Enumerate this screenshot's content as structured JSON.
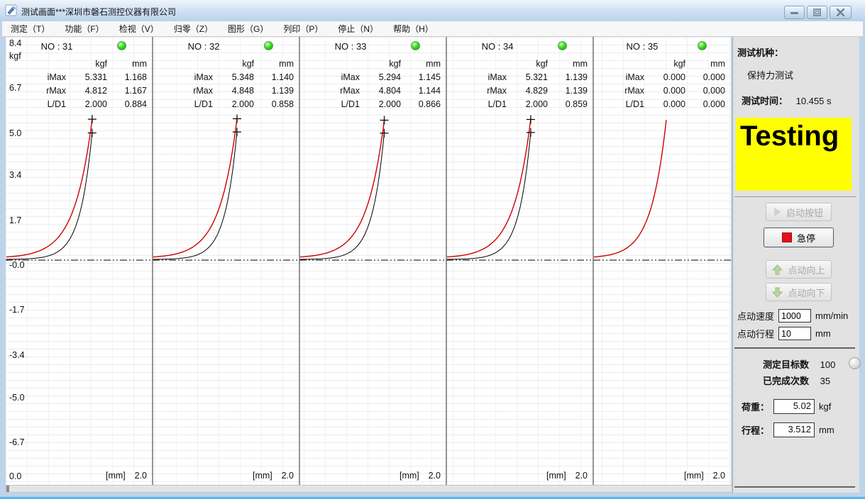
{
  "window": {
    "title": "测试画面***深圳市磐石测控仪器有限公司",
    "minimize_glyph": "—",
    "close_glyph": "✕"
  },
  "menu": {
    "items": [
      "测定（T）",
      "功能（F）",
      "检视（V）",
      "归零（Z）",
      "图形（G）",
      "列印（P）",
      "停止（N）",
      "帮助（H）"
    ]
  },
  "sidebar": {
    "machine_type_label": "测试机种：",
    "machine_type_value": "保持力测试",
    "test_time_label": "测试时间：",
    "test_time_value": "10.455 s",
    "status_banner": "Testing",
    "banner_bg": "#ffff00",
    "start_button": "启动按钮",
    "estop_button": "急停",
    "jog_up_button": "点动向上",
    "jog_down_button": "点动向下",
    "jog_speed_label": "点动速度",
    "jog_speed_value": "1000",
    "jog_speed_unit": "mm/min",
    "jog_stroke_label": "点动行程",
    "jog_stroke_value": "10",
    "jog_stroke_unit": "mm",
    "target_count_label": "测定目标数",
    "target_count_value": "100",
    "completed_label": "已完成次数",
    "completed_value": "35",
    "load_label": "荷重：",
    "load_value": "5.02",
    "load_unit": "kgf",
    "stroke_label": "行程：",
    "stroke_value": "3.512",
    "stroke_unit": "mm"
  },
  "chart_data": {
    "type": "line",
    "title": "Holding-force test curves, force (kgf) vs displacement (mm), 5 consecutive test cycles",
    "y_unit": "kgf",
    "ylim": [
      -8.4,
      8.4
    ],
    "y_ticks": [
      {
        "label": "8.4",
        "v": 8.4
      },
      {
        "label": "6.7",
        "v": 6.7
      },
      {
        "label": "5.0",
        "v": 5.0
      },
      {
        "label": "3.4",
        "v": 3.4
      },
      {
        "label": "1.7",
        "v": 1.7
      },
      {
        "label": "-0.0",
        "v": 0
      },
      {
        "label": "-1.7",
        "v": -1.7
      },
      {
        "label": "-3.4",
        "v": -3.4
      },
      {
        "label": "-5.0",
        "v": -5.0
      },
      {
        "label": "-6.7",
        "v": -6.7
      }
    ],
    "x_origin_label": "0.0",
    "x_axis_label": "[mm]",
    "x_max_label": "2.0",
    "x_range": [
      0,
      2
    ],
    "grid": true,
    "series_colors": {
      "load": "#cf0000",
      "return": "#000000"
    },
    "col_headers": [
      "kgf",
      "mm"
    ],
    "panels": [
      {
        "no_label": "NO : 31",
        "led": "green",
        "markers": true,
        "rows": [
          {
            "label": "iMax",
            "kgf": "5.331",
            "mm": "1.168"
          },
          {
            "label": "rMax",
            "kgf": "4.812",
            "mm": "1.167"
          },
          {
            "label": "L/D1",
            "kgf": "2.000",
            "mm": "0.884"
          }
        ],
        "curves": {
          "red": {
            "peak_kgf": 5.331,
            "peak_mm": 1.168
          },
          "black": {
            "peak_kgf": 4.812,
            "peak_mm": 1.167
          }
        }
      },
      {
        "no_label": "NO : 32",
        "led": "green",
        "markers": true,
        "rows": [
          {
            "label": "iMax",
            "kgf": "5.348",
            "mm": "1.140"
          },
          {
            "label": "rMax",
            "kgf": "4.848",
            "mm": "1.139"
          },
          {
            "label": "L/D1",
            "kgf": "2.000",
            "mm": "0.858"
          }
        ],
        "curves": {
          "red": {
            "peak_kgf": 5.348,
            "peak_mm": 1.14
          },
          "black": {
            "peak_kgf": 4.848,
            "peak_mm": 1.139
          }
        }
      },
      {
        "no_label": "NO : 33",
        "led": "green",
        "markers": true,
        "rows": [
          {
            "label": "iMax",
            "kgf": "5.294",
            "mm": "1.145"
          },
          {
            "label": "rMax",
            "kgf": "4.804",
            "mm": "1.144"
          },
          {
            "label": "L/D1",
            "kgf": "2.000",
            "mm": "0.866"
          }
        ],
        "curves": {
          "red": {
            "peak_kgf": 5.294,
            "peak_mm": 1.145
          },
          "black": {
            "peak_kgf": 4.804,
            "peak_mm": 1.144
          }
        }
      },
      {
        "no_label": "NO : 34",
        "led": "green",
        "markers": true,
        "rows": [
          {
            "label": "iMax",
            "kgf": "5.321",
            "mm": "1.139"
          },
          {
            "label": "rMax",
            "kgf": "4.829",
            "mm": "1.139"
          },
          {
            "label": "L/D1",
            "kgf": "2.000",
            "mm": "0.859"
          }
        ],
        "curves": {
          "red": {
            "peak_kgf": 5.321,
            "peak_mm": 1.139
          },
          "black": {
            "peak_kgf": 4.829,
            "peak_mm": 1.139
          }
        }
      },
      {
        "no_label": "NO : 35",
        "led": "green",
        "markers": false,
        "rows": [
          {
            "label": "iMax",
            "kgf": "0.000",
            "mm": "0.000"
          },
          {
            "label": "rMax",
            "kgf": "0.000",
            "mm": "0.000"
          },
          {
            "label": "L/D1",
            "kgf": "0.000",
            "mm": "0.000"
          }
        ],
        "curves": {
          "red": {
            "peak_kgf": 5.3,
            "peak_mm": 1.05
          },
          "black": null
        }
      }
    ]
  }
}
